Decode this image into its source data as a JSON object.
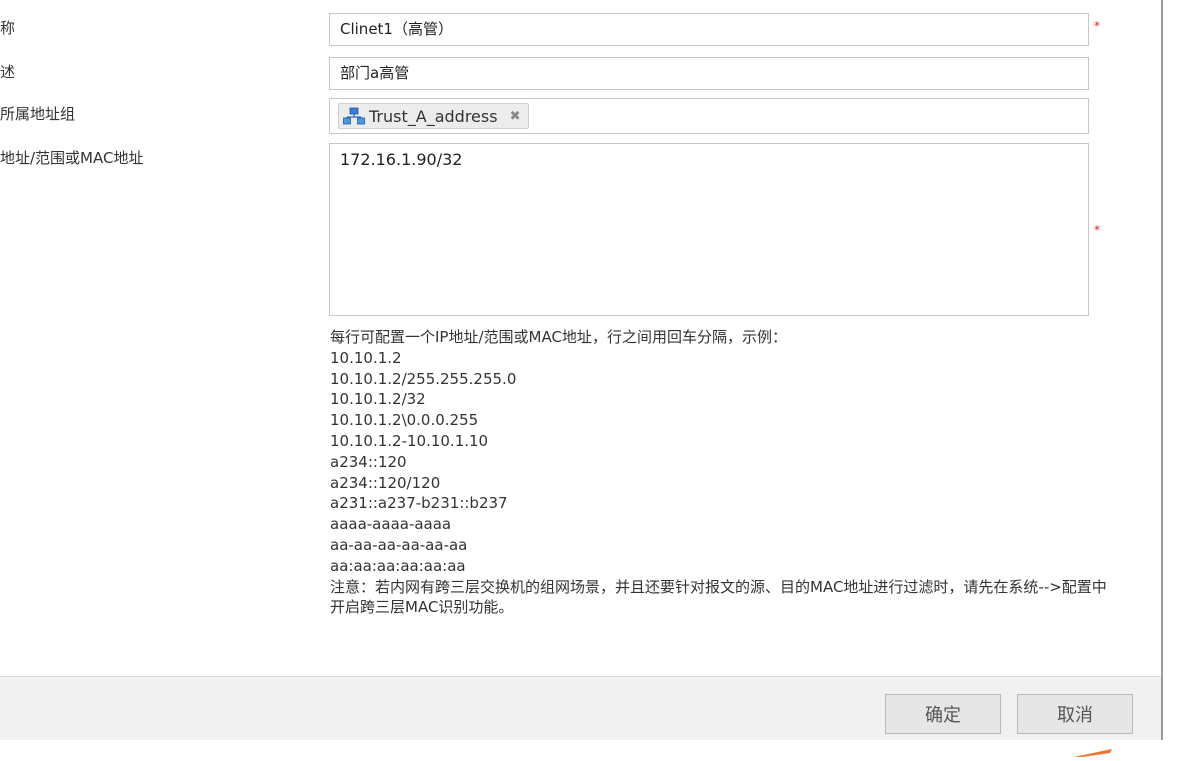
{
  "form": {
    "name": {
      "label": "称",
      "value": "Clinet1（高管）",
      "required_mark": "*"
    },
    "description": {
      "label": "述",
      "value": "部门a高管"
    },
    "address_group": {
      "label": "所属地址组",
      "tag": "Trust_A_address",
      "remove_glyph": "✖"
    },
    "address": {
      "label": "地址/范围或MAC地址",
      "value": "172.16.1.90/32",
      "required_mark": "*"
    }
  },
  "help": {
    "intro": "每行可配置一个IP地址/范围或MAC地址，行之间用回车分隔，示例：",
    "examples": [
      "10.10.1.2",
      "10.10.1.2/255.255.255.0",
      "10.10.1.2/32",
      "10.10.1.2\\0.0.0.255",
      "10.10.1.2-10.10.1.10",
      "a234::120",
      "a234::120/120",
      "a231::a237-b231::b237",
      "aaaa-aaaa-aaaa",
      "aa-aa-aa-aa-aa-aa",
      "aa:aa:aa:aa:aa:aa"
    ],
    "note": "注意：若内网有跨三层交换机的组网场景，并且还要针对报文的源、目的MAC地址进行过滤时，请先在系统-->配置中开启跨三层MAC识别功能。"
  },
  "footer": {
    "ok_label": "确定",
    "cancel_label": "取消"
  },
  "colors": {
    "required": "#e02020",
    "pointer": "#f07030",
    "network_icon": "#3a7bd5"
  }
}
